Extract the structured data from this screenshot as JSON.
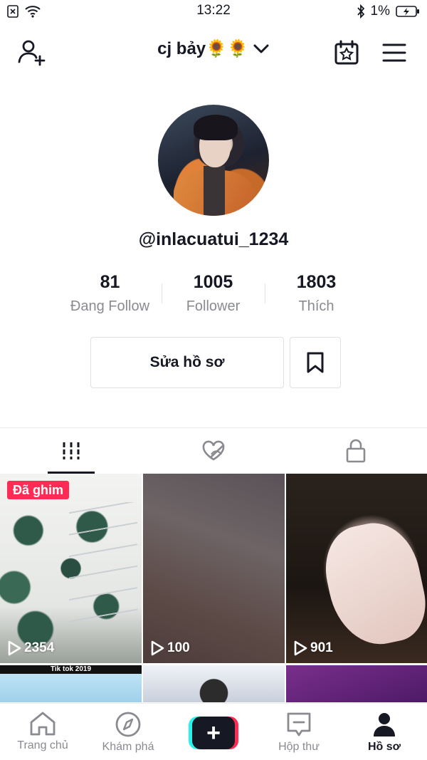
{
  "status_bar": {
    "time": "13:22",
    "battery": "1%"
  },
  "header": {
    "title": "cj bảy🌻🌻"
  },
  "profile": {
    "username": "@inlacuatui_1234",
    "stats": [
      {
        "value": "81",
        "label": "Đang Follow"
      },
      {
        "value": "1005",
        "label": "Follower"
      },
      {
        "value": "1803",
        "label": "Thích"
      }
    ],
    "edit_label": "Sửa hồ sơ"
  },
  "videos": [
    {
      "badge": "Đã ghim",
      "views": "2354"
    },
    {
      "views": "100"
    },
    {
      "views": "901"
    },
    {
      "banner": "Tik tok 2019"
    }
  ],
  "nav": {
    "home": "Trang chủ",
    "discover": "Khám phá",
    "inbox": "Hộp thư",
    "profile": "Hồ sơ"
  },
  "colors": {
    "accent": "#fe2c55",
    "cyan": "#25f4ee",
    "text": "#161823",
    "secondary": "#8a8b91"
  }
}
